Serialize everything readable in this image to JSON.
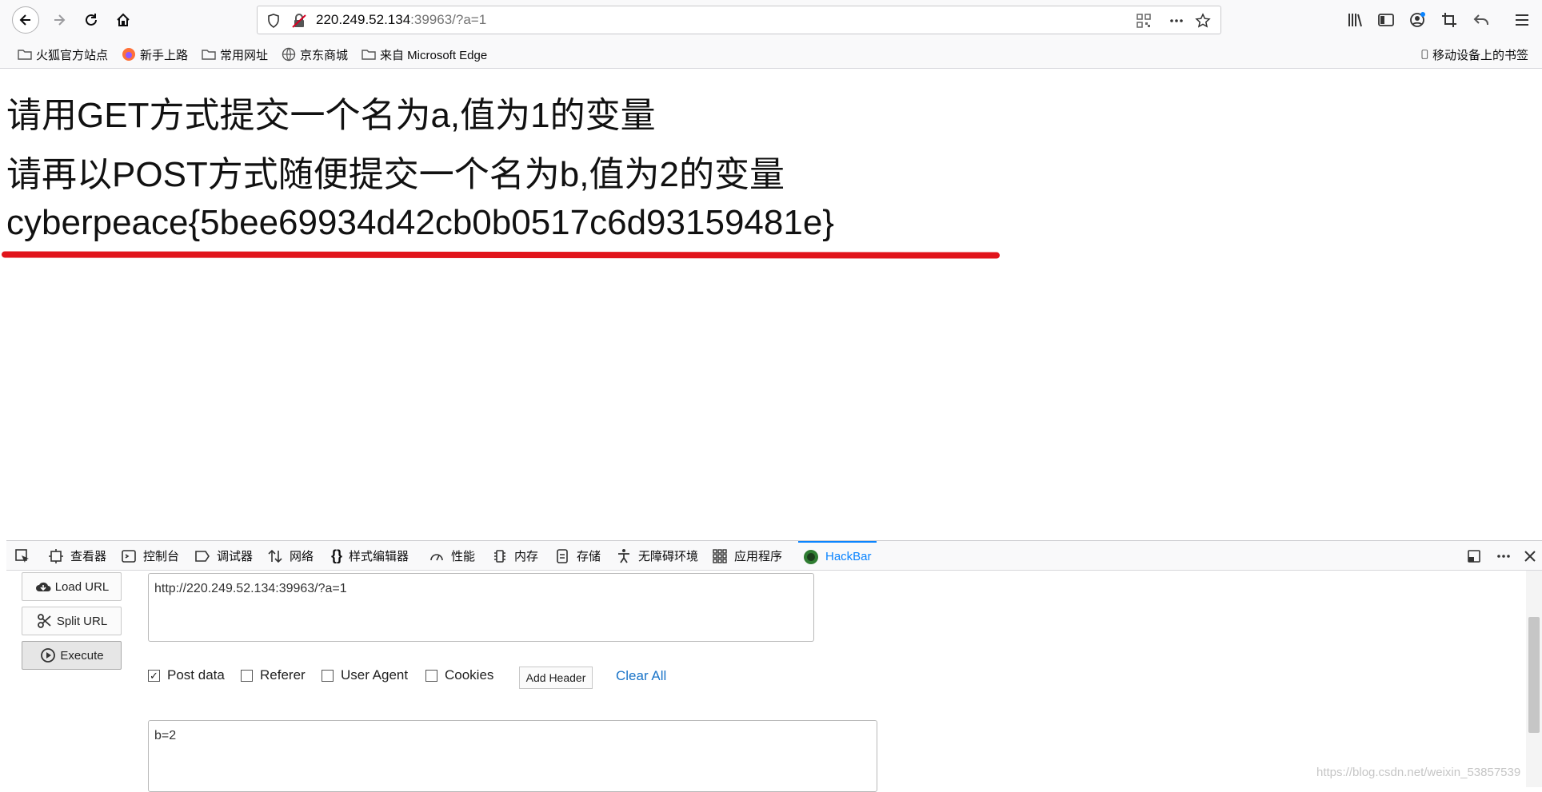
{
  "browser": {
    "url_host": "220.249.52.134",
    "url_rest": ":39963/?a=1"
  },
  "bookmarks": [
    {
      "label": "火狐官方站点",
      "icon": "folder-icon"
    },
    {
      "label": "新手上路",
      "icon": "firefox-icon"
    },
    {
      "label": "常用网址",
      "icon": "folder-icon"
    },
    {
      "label": "京东商城",
      "icon": "globe-icon"
    },
    {
      "label": "来自 Microsoft Edge",
      "icon": "folder-icon"
    }
  ],
  "mobile_bookmarks": "移动设备上的书签",
  "page": {
    "line1": "请用GET方式提交一个名为a,值为1的变量",
    "line2": "请再以POST方式随便提交一个名为b,值为2的变量",
    "flag": "cyberpeace{5bee69934d42cb0b0517c6d93159481e}"
  },
  "devtools": {
    "tabs": [
      "查看器",
      "控制台",
      "调试器",
      "网络",
      "样式编辑器",
      "性能",
      "内存",
      "存储",
      "无障碍环境",
      "应用程序",
      "HackBar"
    ],
    "active_tab": "HackBar"
  },
  "hackbar": {
    "load_url": "Load URL",
    "split_url": "Split URL",
    "execute": "Execute",
    "url_value": "http://220.249.52.134:39963/?a=1",
    "post_data_label": "Post data",
    "post_data_checked": true,
    "referer_label": "Referer",
    "user_agent_label": "User Agent",
    "cookies_label": "Cookies",
    "add_header": "Add Header",
    "clear_all": "Clear All",
    "post_body": "b=2"
  },
  "watermark": "https://blog.csdn.net/weixin_53857539"
}
